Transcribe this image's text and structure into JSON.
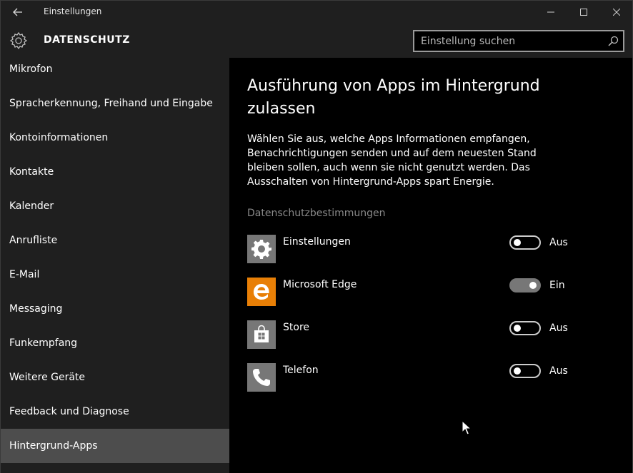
{
  "window": {
    "title": "Einstellungen"
  },
  "header": {
    "title": "DATENSCHUTZ",
    "search_placeholder": "Einstellung suchen"
  },
  "sidebar": {
    "items": [
      {
        "label": "Mikrofon"
      },
      {
        "label": "Spracherkennung, Freihand und Eingabe"
      },
      {
        "label": "Kontoinformationen"
      },
      {
        "label": "Kontakte"
      },
      {
        "label": "Kalender"
      },
      {
        "label": "Anrufliste"
      },
      {
        "label": "E-Mail"
      },
      {
        "label": "Messaging"
      },
      {
        "label": "Funkempfang"
      },
      {
        "label": "Weitere Geräte"
      },
      {
        "label": "Feedback und Diagnose"
      },
      {
        "label": "Hintergrund-Apps",
        "selected": true
      }
    ]
  },
  "main": {
    "title": "Ausführung von Apps im Hintergrund zulassen",
    "description": "Wählen Sie aus, welche Apps Informationen empfangen, Benachrichtigungen senden und auf dem neuesten Stand bleiben sollen, auch wenn sie nicht genutzt werden. Das Ausschalten von Hintergrund-Apps spart Energie.",
    "section_label": "Datenschutzbestimmungen",
    "apps": [
      {
        "name": "Einstellungen",
        "state": "Aus",
        "on": false,
        "icon": "gear-icon",
        "icon_bg": "#777777"
      },
      {
        "name": "Microsoft Edge",
        "state": "Ein",
        "on": true,
        "icon": "edge-icon",
        "icon_bg": "#e87f06"
      },
      {
        "name": "Store",
        "state": "Aus",
        "on": false,
        "icon": "store-icon",
        "icon_bg": "#777777"
      },
      {
        "name": "Telefon",
        "state": "Aus",
        "on": false,
        "icon": "phone-icon",
        "icon_bg": "#777777"
      }
    ]
  },
  "colors": {
    "accent_on": "#777777",
    "sidebar_bg": "#1f1f1f",
    "selected_bg": "#4d4d4d",
    "content_bg": "#000000"
  }
}
